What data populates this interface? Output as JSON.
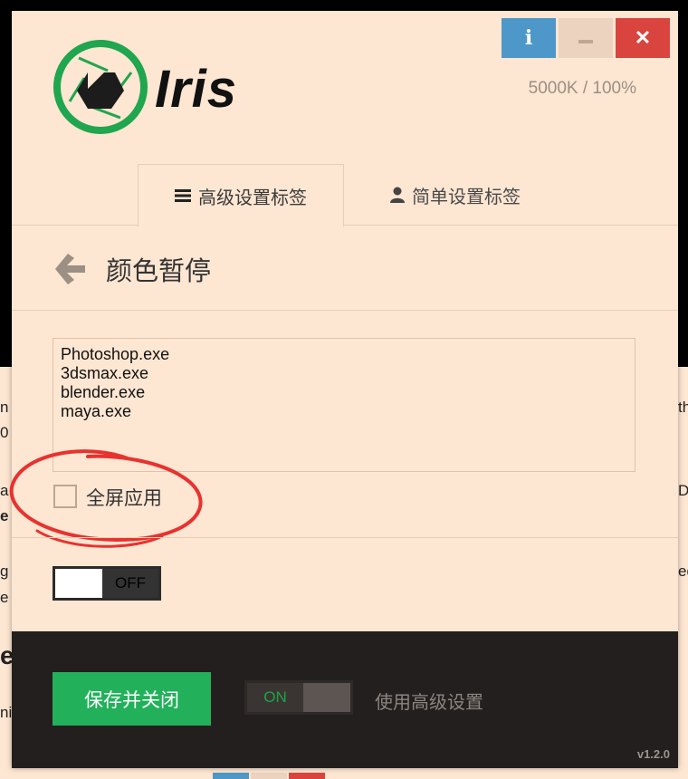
{
  "background_page": {
    "fragments": [
      "n",
      "0",
      "a",
      "e",
      "g i",
      "e",
      "e",
      "ni",
      "th",
      "D",
      "ed"
    ]
  },
  "window": {
    "info_button": "i",
    "close_button": "✕",
    "colors": {
      "info": "#4d98c8",
      "minimize": "#ecd3c0",
      "close": "#d9453e"
    }
  },
  "header": {
    "app_name": "Iris",
    "status": "5000K / 100%"
  },
  "tabs": [
    {
      "label": "高级设置标签",
      "icon": "menu-icon",
      "active": true
    },
    {
      "label": "简单设置标签",
      "icon": "user-icon",
      "active": false
    }
  ],
  "section": {
    "title": "颜色暂停",
    "apps_text": "Photoshop.exe\n3dsmax.exe\nblender.exe\nmaya.exe",
    "fullscreen_label": "全屏应用",
    "fullscreen_checked": false,
    "toggle_label": "OFF"
  },
  "footer": {
    "save_button": "保存并关闭",
    "toggle_label": "ON",
    "advanced_label": "使用高级设置",
    "version": "v1.2.0",
    "colors": {
      "save": "#22b15a",
      "background": "#231f1e"
    }
  }
}
